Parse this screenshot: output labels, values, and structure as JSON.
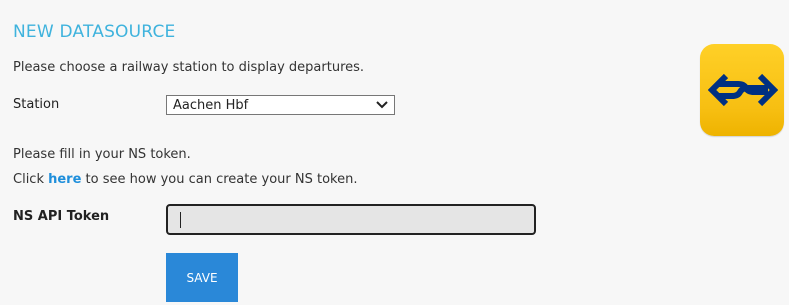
{
  "page": {
    "title": "NEW DATASOURCE",
    "intro": "Please choose a railway station to display departures."
  },
  "station": {
    "label": "Station",
    "selected": "Aachen Hbf"
  },
  "token": {
    "fill_text": "Please fill in your NS token.",
    "click_prefix": "Click ",
    "link_text": "here",
    "click_suffix": " to see how you can create your NS token.",
    "label": "NS API Token",
    "value": "",
    "placeholder": ""
  },
  "actions": {
    "save_label": "SAVE"
  },
  "colors": {
    "title": "#3fb3dd",
    "link": "#1f8fdb",
    "button": "#2a88d8",
    "logo_yellow": "#ffc917",
    "logo_blue": "#003082"
  },
  "icons": {
    "logo": "ns-logo-icon",
    "chevron": "chevron-down-icon"
  }
}
